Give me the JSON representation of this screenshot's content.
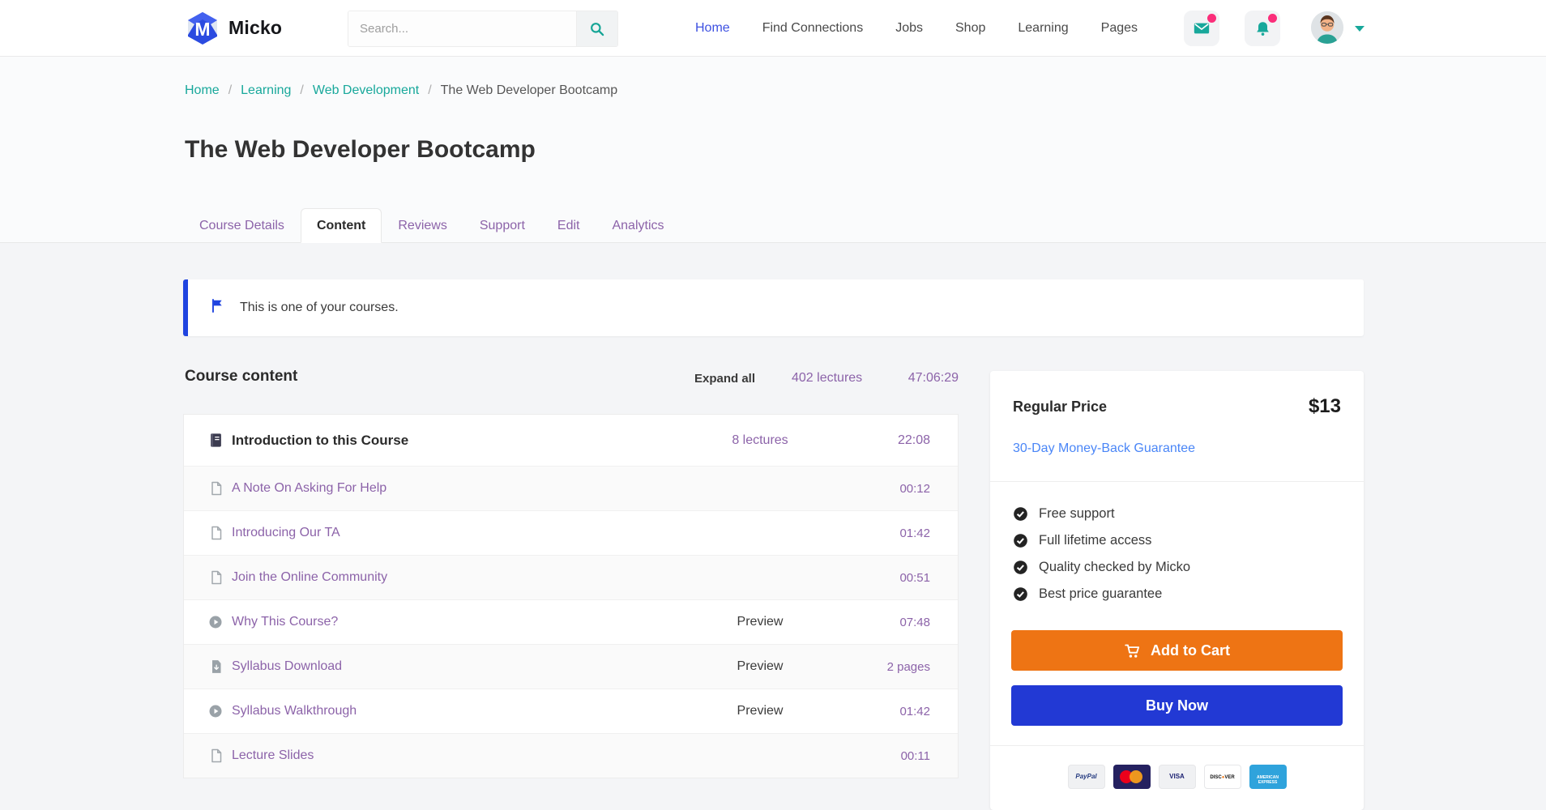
{
  "navbar": {
    "brand": "Micko",
    "search": {
      "placeholder": "Search..."
    },
    "links": [
      "Home",
      "Find Connections",
      "Jobs",
      "Shop",
      "Learning",
      "Pages"
    ],
    "active_link": "Home"
  },
  "icons": {
    "logo": "hexagon-gem-logo",
    "search": "magnifier",
    "messages": "envelope",
    "notifications": "bell",
    "profile": "avatar",
    "profile_dropdown": "chevron-down",
    "alert": "flag",
    "section": "book",
    "article": "file",
    "video": "play-circle",
    "download": "file-arrow-down",
    "feature": "check-circle",
    "add_to_cart": "shopping-cart"
  },
  "breadcrumb": {
    "items": [
      "Home",
      "Learning",
      "Web Development"
    ],
    "separator": "/",
    "current": "The Web Developer Bootcamp"
  },
  "page_title": "The Web Developer Bootcamp",
  "tabs": {
    "items": [
      "Course Details",
      "Content",
      "Reviews",
      "Support",
      "Edit",
      "Analytics"
    ],
    "active": "Content"
  },
  "alert": {
    "message": "This is one of your courses."
  },
  "course_content": {
    "heading": "Course content",
    "expand_all_label": "Expand all",
    "total_lectures": "402 lectures",
    "total_duration": "47:06:29",
    "section": {
      "title": "Introduction to this Course",
      "lecture_count": "8 lectures",
      "duration": "22:08"
    },
    "rows": [
      {
        "title": "A Note On Asking For Help",
        "type": "article",
        "preview": "",
        "duration": "00:12"
      },
      {
        "title": "Introducing Our TA",
        "type": "article",
        "preview": "",
        "duration": "01:42"
      },
      {
        "title": "Join the Online Community",
        "type": "article",
        "preview": "",
        "duration": "00:51"
      },
      {
        "title": "Why This Course?",
        "type": "video",
        "preview": "Preview",
        "duration": "07:48"
      },
      {
        "title": "Syllabus Download",
        "type": "download",
        "preview": "Preview",
        "duration": "2 pages"
      },
      {
        "title": "Syllabus Walkthrough",
        "type": "video",
        "preview": "Preview",
        "duration": "01:42"
      },
      {
        "title": "Lecture Slides",
        "type": "article",
        "preview": "",
        "duration": "00:11"
      }
    ]
  },
  "purchase_card": {
    "price_label": "Regular Price",
    "price": "$13",
    "guarantee": "30-Day Money-Back Guarantee",
    "features": [
      "Free support",
      "Full lifetime access",
      "Quality checked by Micko",
      "Best price guarantee"
    ],
    "add_to_cart_label": "Add to Cart",
    "buy_now_label": "Buy Now",
    "payment_methods": [
      "PayPal",
      "MasterCard",
      "VISA",
      "Discover",
      "American Express"
    ]
  },
  "colors": {
    "accent_teal": "#18a89b",
    "nav_active_blue": "#3e51e1",
    "alert_blue": "#1f44e0",
    "link_purple": "#8c63a9",
    "guarantee_blue": "#4a86f7",
    "cart_orange": "#ee7414",
    "buy_blue": "#2239d4",
    "badge_pink": "#fb2e7a"
  }
}
